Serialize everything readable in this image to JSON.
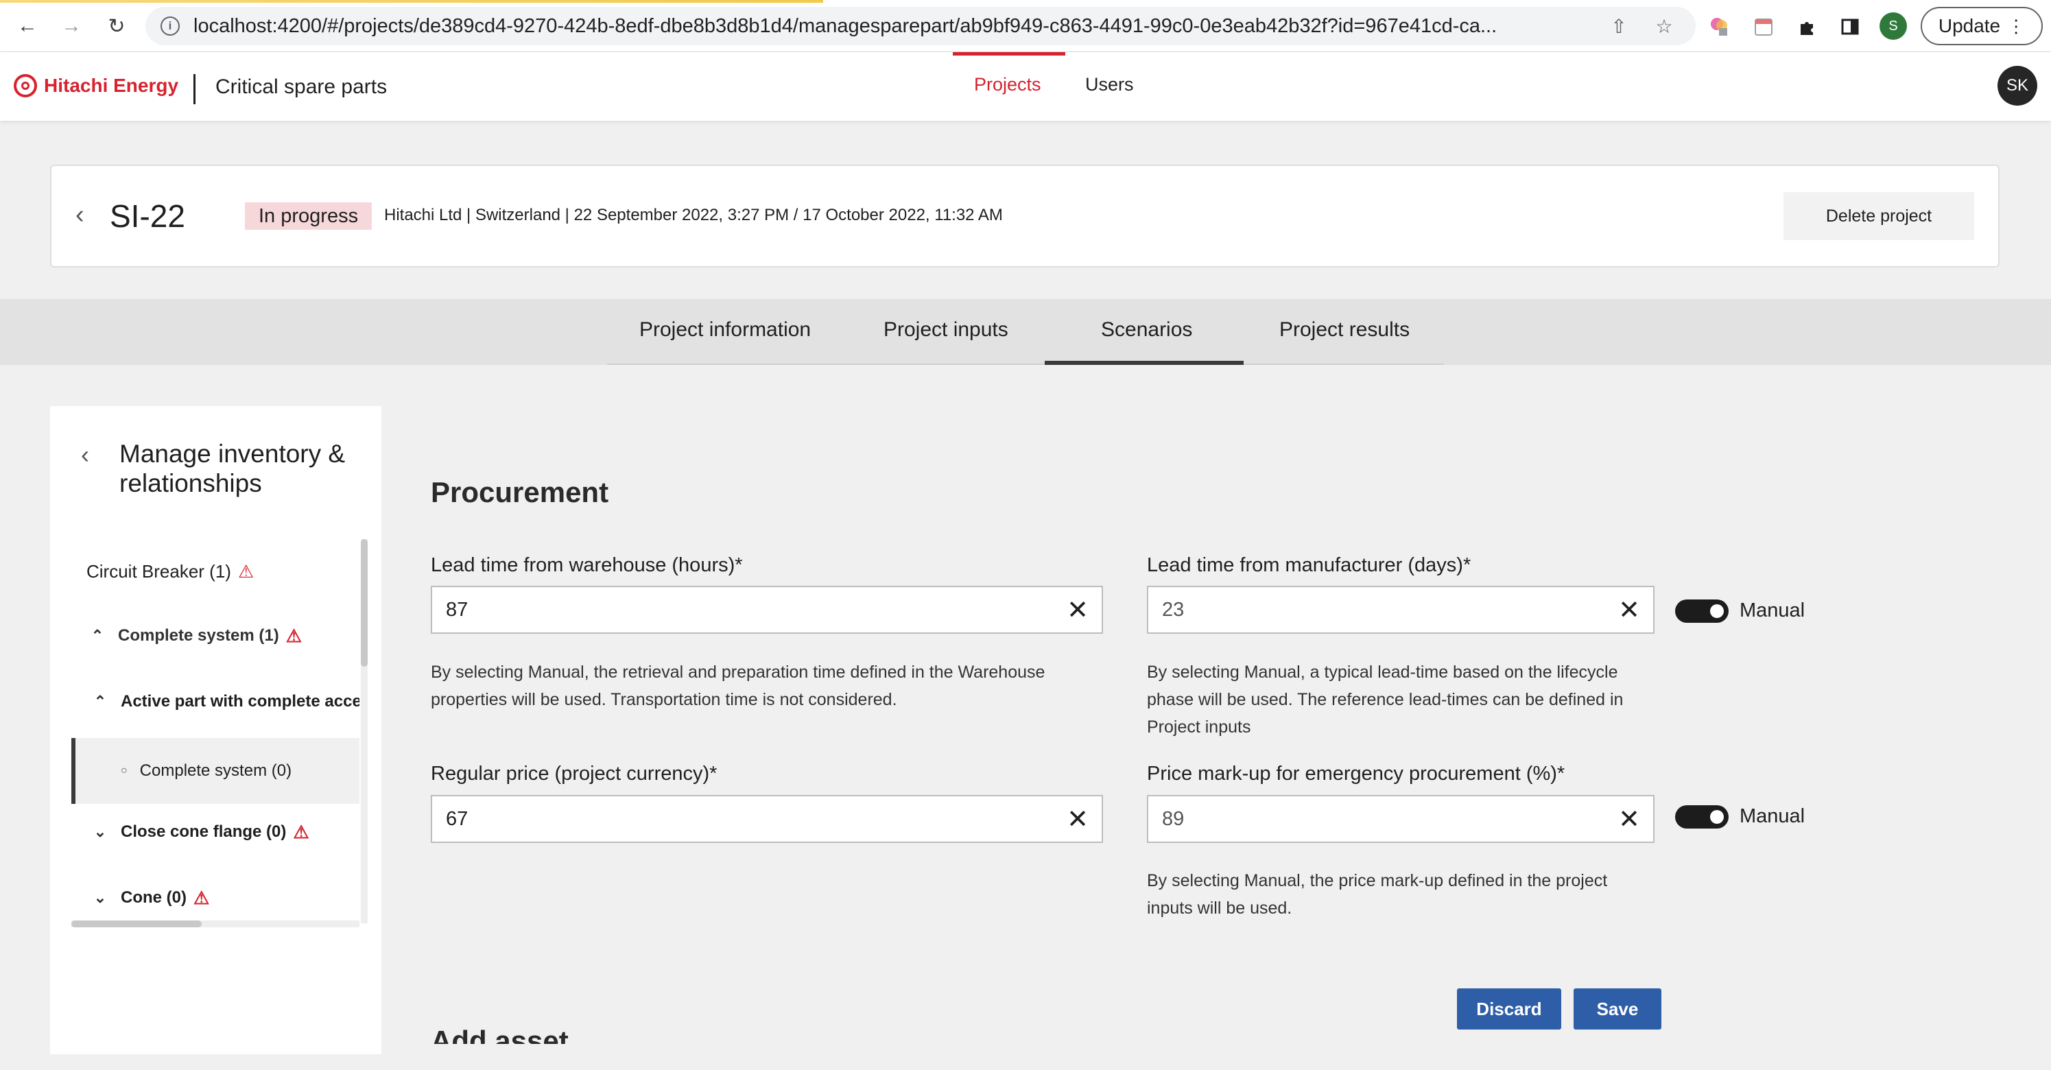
{
  "browser": {
    "url": "localhost:4200/#/projects/de389cd4-9270-424b-8edf-dbe8b3d8b1d4/managesparepart/ab9bf949-c863-4491-99c0-0e3eab42b32f?id=967e41cd-ca...",
    "profile_initial": "S",
    "update_label": "Update"
  },
  "header": {
    "brand": "Hitachi Energy",
    "app_title": "Critical spare parts",
    "nav": [
      {
        "label": "Projects",
        "active": true
      },
      {
        "label": "Users",
        "active": false
      }
    ],
    "user_initials": "SK",
    "accent_color": "#d5232f"
  },
  "project": {
    "id": "SI-22",
    "status": "In progress",
    "meta": "Hitachi Ltd | Switzerland | 22 September 2022, 3:27 PM / 17 October 2022, 11:32 AM",
    "delete_label": "Delete project"
  },
  "tabs": [
    {
      "label": "Project information",
      "active": false
    },
    {
      "label": "Project inputs",
      "active": false
    },
    {
      "label": "Scenarios",
      "active": true
    },
    {
      "label": "Project results",
      "active": false
    }
  ],
  "sidebar": {
    "title": "Manage inventory & relationships",
    "tree": [
      {
        "label": "Circuit Breaker (1)",
        "warning": true
      },
      {
        "label": "Complete system (1)",
        "warning": true,
        "expanded": true
      },
      {
        "label": "Active part with complete acce",
        "warning": false,
        "expanded": true
      },
      {
        "label": "Complete system (0)",
        "warning": false,
        "selected": true
      },
      {
        "label": "Close cone flange (0)",
        "warning": true,
        "expanded": false
      },
      {
        "label": "Cone (0)",
        "warning": true,
        "expanded": false
      }
    ]
  },
  "procurement": {
    "title": "Procurement",
    "lead_warehouse": {
      "label": "Lead time from warehouse (hours)*",
      "value": "87",
      "help": "By selecting Manual, the retrieval and preparation time defined in the Warehouse properties will be used. Transportation time is not considered."
    },
    "lead_manufacturer": {
      "label": "Lead time from manufacturer (days)*",
      "value": "23",
      "toggle_label": "Manual",
      "toggle_on": true,
      "help": "By selecting Manual, a typical lead-time based on the lifecycle phase will be used. The reference lead-times can be defined in Project inputs"
    },
    "regular_price": {
      "label": "Regular price (project currency)*",
      "value": "67"
    },
    "price_markup": {
      "label": "Price mark-up for emergency procurement (%)*",
      "value": "89",
      "toggle_label": "Manual",
      "toggle_on": true,
      "help": "By selecting Manual, the price mark-up defined in the project inputs will be used."
    },
    "discard_label": "Discard",
    "save_label": "Save"
  },
  "next_section": {
    "title": "Add asset"
  },
  "icons": {
    "back": "arrow-left-icon",
    "forward": "arrow-right-icon",
    "reload": "reload-icon",
    "info": "info-icon",
    "share": "share-icon",
    "star": "star-icon",
    "extensions": "puzzle-icon",
    "sidebar": "sidebar-icon",
    "menu": "kebab-menu-icon",
    "warning": "warning-triangle-icon",
    "clear": "close-icon"
  }
}
